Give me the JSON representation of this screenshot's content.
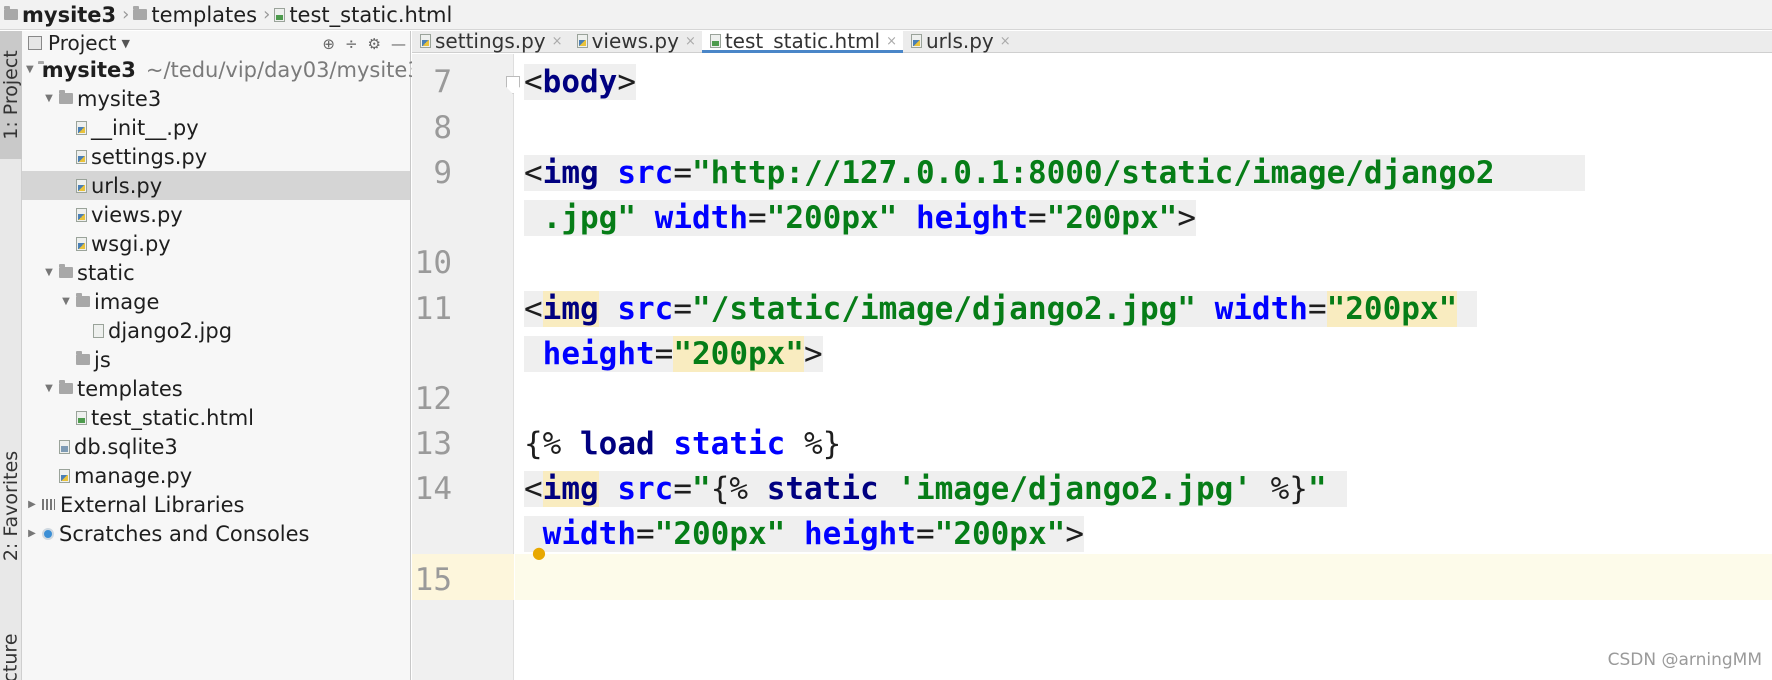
{
  "breadcrumb": [
    "mysite3",
    "templates",
    "test_static.html"
  ],
  "tool_strip": {
    "project_tab": "1: Project",
    "favorites_tab": "2: Favorites",
    "structure_tab": "cture"
  },
  "project_panel": {
    "title": "Project",
    "tree": [
      {
        "label": "mysite3",
        "detail": "~/tedu/vip/day03/mysite3",
        "type": "folder",
        "level": 0,
        "expanded": true,
        "bold": true
      },
      {
        "label": "mysite3",
        "type": "folder",
        "level": 1,
        "expanded": true
      },
      {
        "label": "__init__.py",
        "type": "py",
        "level": 2
      },
      {
        "label": "settings.py",
        "type": "py",
        "level": 2
      },
      {
        "label": "urls.py",
        "type": "py",
        "level": 2,
        "selected": true
      },
      {
        "label": "views.py",
        "type": "py",
        "level": 2
      },
      {
        "label": "wsgi.py",
        "type": "py",
        "level": 2
      },
      {
        "label": "static",
        "type": "folder",
        "level": 1,
        "expanded": true
      },
      {
        "label": "image",
        "type": "folder",
        "level": 2,
        "expanded": true
      },
      {
        "label": "django2.jpg",
        "type": "img",
        "level": 3
      },
      {
        "label": "js",
        "type": "folder",
        "level": 2
      },
      {
        "label": "templates",
        "type": "folder",
        "level": 1,
        "expanded": true
      },
      {
        "label": "test_static.html",
        "type": "html",
        "level": 2
      },
      {
        "label": "db.sqlite3",
        "type": "db",
        "level": 1
      },
      {
        "label": "manage.py",
        "type": "py",
        "level": 1
      },
      {
        "label": "External Libraries",
        "type": "lib",
        "level": 0,
        "expanded": false
      },
      {
        "label": "Scratches and Consoles",
        "type": "scratch",
        "level": 0,
        "expanded": false
      }
    ]
  },
  "editor_tabs": [
    {
      "label": "settings.py",
      "type": "py",
      "active": false
    },
    {
      "label": "views.py",
      "type": "py",
      "active": false
    },
    {
      "label": "test_static.html",
      "type": "html",
      "active": true
    },
    {
      "label": "urls.py",
      "type": "py",
      "active": false
    }
  ],
  "editor": {
    "line_numbers": [
      "7",
      "8",
      "9",
      "10",
      "11",
      "12",
      "13",
      "14",
      "15"
    ],
    "code": {
      "l7_tag": "body",
      "l9_tag": "img",
      "l9_attr1": "src",
      "l9_val1": "\"http://127.0.0.1:8000/static/image/django2",
      "l9b_val1_end": ".jpg\"",
      "l9b_attr2": "width",
      "l9b_val2": "\"200px\"",
      "l9b_attr3": "height",
      "l9b_val3": "\"200px\"",
      "l11_tag": "img",
      "l11_attr1": "src",
      "l11_val1": "\"/static/image/django2.jpg\"",
      "l11_attr2": "width",
      "l11_val2": "\"200px\"",
      "l11b_attr3": "height",
      "l11b_val3": "\"200px\"",
      "l13_open": "{%",
      "l13_kw": "load",
      "l13_name": "static",
      "l13_close": "%}",
      "l14_tag": "img",
      "l14_attr1": "src",
      "l14_q1": "\"",
      "l14_open": "{%",
      "l14_name": "static",
      "l14_arg": "'image/django2.jpg'",
      "l14_close": "%}",
      "l14_q2": "\"",
      "l14b_attr2": "width",
      "l14b_val2": "\"200px\"",
      "l14b_attr3": "height",
      "l14b_val3": "\"200px\""
    }
  },
  "watermark": "CSDN @arningMM"
}
